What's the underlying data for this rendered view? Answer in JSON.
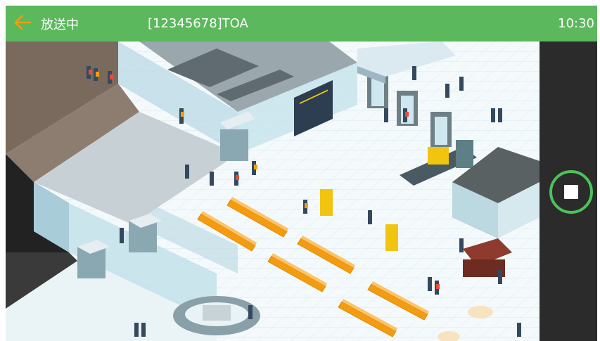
{
  "header": {
    "title": "放送中",
    "channel": "[12345678]TOA",
    "time": "10:30"
  },
  "colors": {
    "header_bg": "#5cb85c",
    "back_arrow": "#f39c12",
    "stop_ring": "#4cc35a",
    "side_panel": "#2b2b2b"
  },
  "icons": {
    "back": "back-arrow-icon",
    "stop": "stop-icon"
  }
}
